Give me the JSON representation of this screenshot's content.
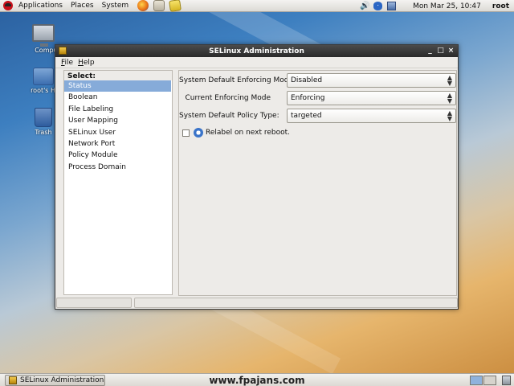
{
  "top_panel": {
    "menus": [
      "Applications",
      "Places",
      "System"
    ],
    "launchers": [
      {
        "icon": "firefox-icon"
      },
      {
        "icon": "mail-icon"
      },
      {
        "icon": "notes-icon"
      }
    ],
    "tray_icons": [
      "volume-icon",
      "bluetooth-icon",
      "network-icon"
    ],
    "clock": "Mon Mar 25, 10:47",
    "user": "root"
  },
  "desktop": {
    "icons": [
      {
        "label": "Comput",
        "icon": "computer-icon"
      },
      {
        "label": "root's Ho",
        "icon": "home-folder-icon"
      },
      {
        "label": "Trash",
        "icon": "trash-icon"
      }
    ]
  },
  "window": {
    "title": "SELinux Administration",
    "controls": [
      "_",
      "□",
      "×"
    ],
    "menubar": [
      "File",
      "Help"
    ],
    "sidebar": {
      "title": "Select:",
      "items": [
        {
          "label": "Status",
          "selected": true
        },
        {
          "label": "Boolean",
          "selected": false
        },
        {
          "label": "File Labeling",
          "selected": false
        },
        {
          "label": "User Mapping",
          "selected": false
        },
        {
          "label": "SELinux User",
          "selected": false
        },
        {
          "label": "Network Port",
          "selected": false
        },
        {
          "label": "Policy Module",
          "selected": false
        },
        {
          "label": "Process Domain",
          "selected": false
        }
      ]
    },
    "status": {
      "default_mode_label": "System Default Enforcing Mode",
      "default_mode_value": "Disabled",
      "current_mode_label": "Current Enforcing Mode",
      "current_mode_value": "Enforcing",
      "policy_type_label": "System Default Policy Type:",
      "policy_type_value": "targeted",
      "relabel_label": "Relabel on next reboot.",
      "relabel_checked": false
    }
  },
  "bottom_panel": {
    "task": "SELinux Administration",
    "watermark": "www.fpajans.com",
    "workspaces": 2,
    "active_workspace": 1
  },
  "colors": {
    "selection": "#86abd9",
    "titlebar": "#2e2e2e",
    "panel": "#dcdad5"
  }
}
